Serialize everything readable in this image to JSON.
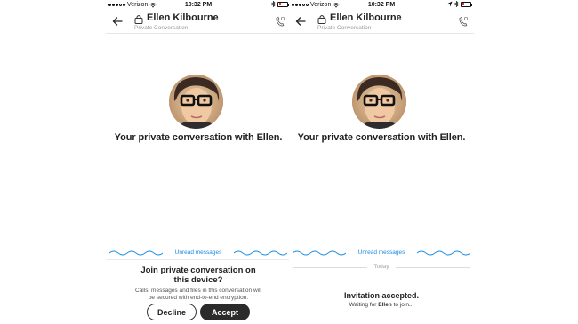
{
  "status": {
    "carrier": "Verizon",
    "time": "10:32 PM",
    "battery_percent": 20
  },
  "header": {
    "title": "Ellen Kilbourne",
    "subtitle": "Private Conversation"
  },
  "intro_text": "Your private conversation with Ellen.",
  "unread_label": "Unread messages",
  "today_label": "Today",
  "prompt": {
    "title": "Join private conversation on this device?",
    "body": "Calls, messages and files in this conversation will be secured with end-to-end encryption.",
    "decline_label": "Decline",
    "accept_label": "Accept"
  },
  "invite": {
    "title": "Invitation accepted.",
    "waiting_prefix": "Waiting for ",
    "waiting_name": "Ellen",
    "waiting_suffix": " to join..."
  },
  "colors": {
    "accent": "#1a8ce0",
    "battery_low": "#e0262b",
    "accept_bg": "#2b2b2b"
  },
  "icons": [
    "back-arrow-icon",
    "lock-icon",
    "call-icon",
    "wifi-icon",
    "bluetooth-icon",
    "location-icon"
  ]
}
